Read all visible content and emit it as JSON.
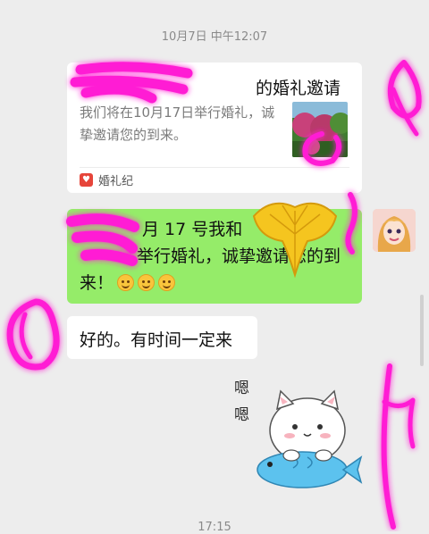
{
  "chat": {
    "timestamp_top": "10月7日 中午12:07",
    "timestamp_bottom": "17:15",
    "card": {
      "title": "的婚礼邀请",
      "description": "我们将在10月17日举行婚礼，诚挚邀请您的到来。",
      "source_label": "婚礼纪",
      "source_icon": "婚礼纪-app-icon"
    },
    "outgoing_message": {
      "line1": "月 17 号我和",
      "line2": "举行婚礼，诚挚邀请您的到",
      "line3": "来！",
      "emoji_count": 3
    },
    "incoming_message": "好的。有时间一定来",
    "sticker": {
      "text_top": "嗯",
      "text_bottom": "嗯"
    }
  },
  "colors": {
    "background": "#ededed",
    "outgoing_bubble": "#95ec69",
    "incoming_bubble": "#ffffff",
    "redaction_scribble": "#ff1fd4"
  }
}
